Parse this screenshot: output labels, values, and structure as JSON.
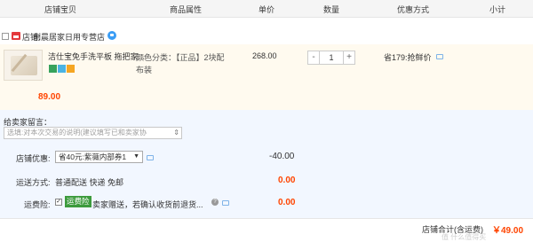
{
  "header": {
    "columns": [
      "店铺宝贝",
      "商品属性",
      "单价",
      "数量",
      "优惠方式",
      "小计"
    ]
  },
  "store": {
    "prefix": "店铺:",
    "name": "创晨居家日用专营店"
  },
  "item": {
    "title_line1": "洁仕宝免手洗平板 拖把家...",
    "color_label": "颜色分类：【正品】2块配",
    "color_label2": "布装",
    "unit_price": "268.00",
    "quantity": "1",
    "qty_minus": "-",
    "qty_plus": "+",
    "discount_label": "省179:抢鲜价",
    "subtotal": "89.00"
  },
  "message": {
    "label": "给卖家留言：",
    "placeholder": "选填:对本次交易的说明(建议填写已和卖家协",
    "dropdown": "⇕"
  },
  "coupon": {
    "label": "店铺优惠:",
    "selected": "省40元:紫薇内部券1",
    "amount": "-40.00"
  },
  "shipping": {
    "label": "运送方式:",
    "option": "普通配送 快递 免邮",
    "amount": "0.00"
  },
  "insurance": {
    "label": "运费险:",
    "check": "✓",
    "tag": "运费险",
    "text": "卖家赠送，若确认收货前退货...",
    "amount": "0.00"
  },
  "footer": {
    "label": "店铺合计(含运费)",
    "total": "￥49.00",
    "watermark": "值 什么值得买"
  },
  "colors": {
    "header_bg": "#f5f5f5",
    "item_bg": "#fffaef",
    "lower_bg": "#f2f7ff",
    "price_red": "#ff4400",
    "insurance_green": "#3d9b3d"
  }
}
